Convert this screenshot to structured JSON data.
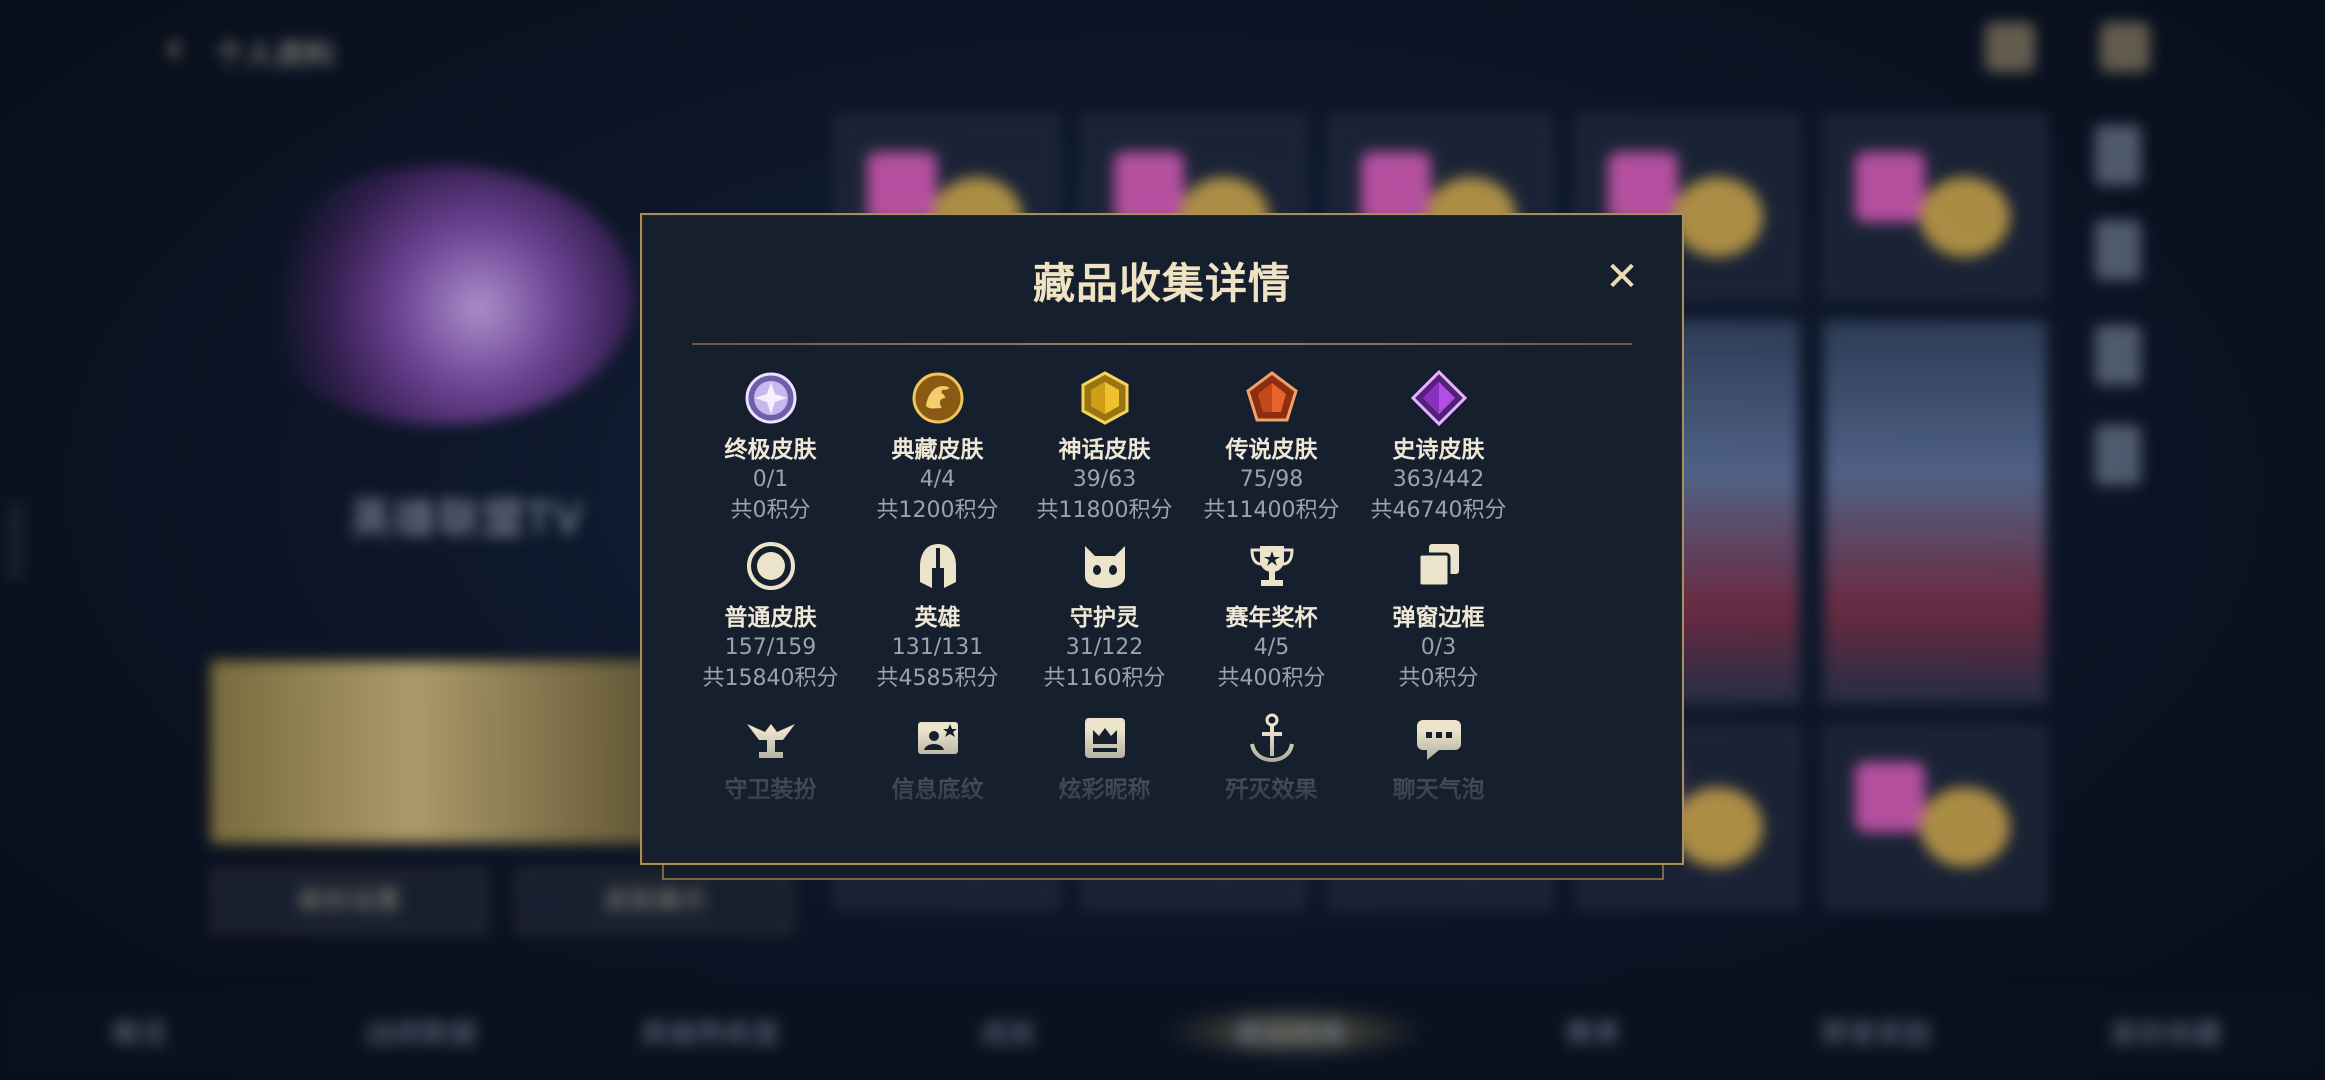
{
  "background": {
    "title": "个人资料",
    "player_name": "英雄联盟TV",
    "left_buttons": [
      "装扮设置",
      "皮肤展示"
    ],
    "bottom_tabs": [
      "概览",
      "战绩数据",
      "英雄熟练度",
      "成就",
      "藏品收集",
      "赛季",
      "荣誉奖励",
      "装扮收藏"
    ],
    "side_id": "7924242"
  },
  "modal": {
    "title": "藏品收集详情",
    "close_icon": "close-icon",
    "categories": [
      {
        "name": "终极皮肤",
        "count": "0/1",
        "score": "共0积分",
        "icon": "ultimate-skin-icon",
        "color": "#b9a4e8"
      },
      {
        "name": "典藏皮肤",
        "count": "4/4",
        "score": "共1200积分",
        "icon": "collection-skin-icon",
        "color": "#e2a93a"
      },
      {
        "name": "神话皮肤",
        "count": "39/63",
        "score": "共11800积分",
        "icon": "mythic-skin-icon",
        "color": "#e8b92e"
      },
      {
        "name": "传说皮肤",
        "count": "75/98",
        "score": "共11400积分",
        "icon": "legendary-skin-icon",
        "color": "#e0642c"
      },
      {
        "name": "史诗皮肤",
        "count": "363/442",
        "score": "共46740积分",
        "icon": "epic-skin-icon",
        "color": "#a33fd6"
      },
      {
        "name": "普通皮肤",
        "count": "157/159",
        "score": "共15840积分",
        "icon": "standard-skin-icon",
        "color": "#e7dcc0"
      },
      {
        "name": "英雄",
        "count": "131/131",
        "score": "共4585积分",
        "icon": "champion-helmet-icon",
        "color": "#e7dcc0"
      },
      {
        "name": "守护灵",
        "count": "31/122",
        "score": "共1160积分",
        "icon": "guardian-spirit-icon",
        "color": "#e7dcc0"
      },
      {
        "name": "赛年奖杯",
        "count": "4/5",
        "score": "共400积分",
        "icon": "trophy-icon",
        "color": "#e7dcc0"
      },
      {
        "name": "弹窗边框",
        "count": "0/3",
        "score": "共0积分",
        "icon": "popup-frame-icon",
        "color": "#e7dcc0"
      },
      {
        "name": "守卫装扮",
        "icon": "ward-skin-icon",
        "color": "#e7dcc0"
      },
      {
        "name": "信息底纹",
        "icon": "info-banner-icon",
        "color": "#e7dcc0"
      },
      {
        "name": "炫彩昵称",
        "icon": "colorful-nickname-icon",
        "color": "#e7dcc0"
      },
      {
        "name": "歼灭效果",
        "icon": "kill-effect-icon",
        "color": "#e7dcc0"
      },
      {
        "name": "聊天气泡",
        "icon": "chat-bubble-icon",
        "color": "#e7dcc0"
      }
    ]
  }
}
